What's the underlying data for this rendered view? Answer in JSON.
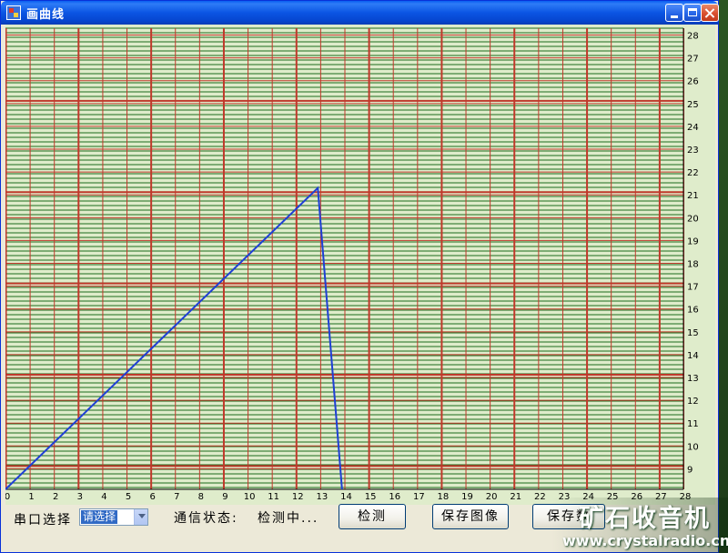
{
  "window": {
    "title": "画曲线"
  },
  "controls": {
    "port_label": "串口选择",
    "port_select_value": "请选择",
    "status_label": "通信状态:",
    "status_value": "检测中...",
    "detect_button": "检测",
    "save_image_button": "保存图像",
    "save_data_button": "保存数"
  },
  "watermark": {
    "brand": "矿石收音机",
    "url": "www.crystalradio.cn"
  },
  "colors": {
    "plot_background": "#dfeccb",
    "minor_grid": "#1e6b1e",
    "major_grid": "#c0392b",
    "line": "#1f3fd6"
  },
  "chart_data": {
    "type": "line",
    "x_ticks": [
      "0",
      "1",
      "2",
      "3",
      "4",
      "5",
      "6",
      "7",
      "8",
      "9",
      "10",
      "11",
      "12",
      "13",
      "14",
      "15",
      "16",
      "17",
      "18",
      "19",
      "20",
      "21",
      "22",
      "23",
      "24",
      "25",
      "26",
      "27",
      "28"
    ],
    "y_ticks": [
      "9",
      "10",
      "11",
      "12",
      "13",
      "14",
      "15",
      "16",
      "17",
      "18",
      "19",
      "20",
      "21",
      "22",
      "23",
      "24",
      "25",
      "26",
      "27",
      "28"
    ],
    "y_tick_last": "28",
    "x_range": [
      0,
      28
    ],
    "y_range": [
      8.1,
      28.3
    ],
    "series": [
      {
        "x": [
          0,
          12.9,
          13.9
        ],
        "y": [
          8.1,
          21.3,
          8.1
        ]
      }
    ],
    "grid": true,
    "y_axis_side": "right"
  }
}
